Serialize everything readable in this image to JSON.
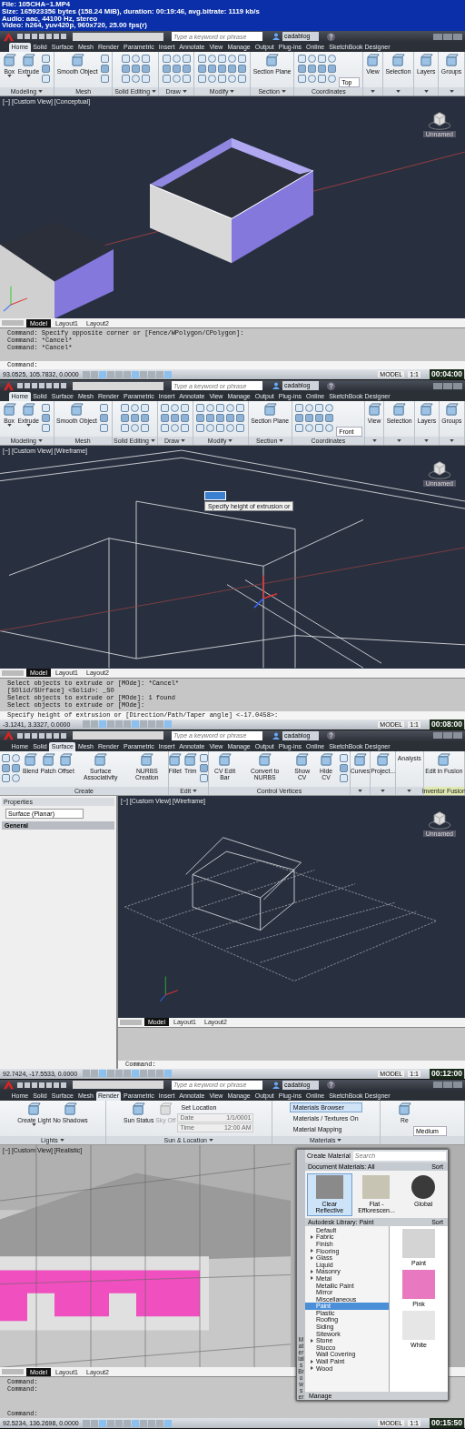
{
  "info": {
    "lines": [
      "File: 105CHA~1.MP4",
      "Size: 165923356 bytes (158.24 MiB), duration: 00:19:46, avg.bitrate: 1119 kb/s",
      "Audio: aac, 44100 Hz, stereo",
      "Video: h264, yuv420p, 960x720, 25.00 fps(r)"
    ]
  },
  "frames": [
    {
      "title_bar": {
        "search_placeholder": "Type a keyword or phrase",
        "user": "cadablog"
      },
      "tabs": [
        {
          "label": "Home",
          "selected": true
        },
        {
          "label": "Solid",
          "selected": false
        },
        {
          "label": "Surface",
          "selected": false
        },
        {
          "label": "Mesh",
          "selected": false
        },
        {
          "label": "Render",
          "selected": false
        },
        {
          "label": "Parametric",
          "selected": false
        },
        {
          "label": "Insert",
          "selected": false
        },
        {
          "label": "Annotate",
          "selected": false
        },
        {
          "label": "View",
          "selected": false
        },
        {
          "label": "Manage",
          "selected": false
        },
        {
          "label": "Output",
          "selected": false
        },
        {
          "label": "Plug-ins",
          "selected": false
        },
        {
          "label": "Online",
          "selected": false
        },
        {
          "label": "SketchBook Designer",
          "selected": false
        }
      ],
      "ribbon": [
        {
          "label": "Modeling",
          "menu": true,
          "tools": [
            {
              "kind": "large",
              "label": "Box",
              "menu": true
            },
            {
              "kind": "large",
              "label": "Extrude",
              "menu": true
            },
            {
              "kind": "column"
            }
          ]
        },
        {
          "label": "Mesh",
          "menu": false,
          "tools": [
            {
              "kind": "large",
              "label": "Smooth Object",
              "menu": false
            },
            {
              "kind": "column"
            }
          ]
        },
        {
          "label": "Solid Editing",
          "menu": true,
          "tools": [
            {
              "kind": "grid-three"
            }
          ]
        },
        {
          "label": "Draw",
          "menu": true,
          "tools": [
            {
              "kind": "grid-three"
            }
          ]
        },
        {
          "label": "Modify",
          "menu": true,
          "tools": [
            {
              "kind": "grid-five"
            }
          ]
        },
        {
          "label": "Section",
          "menu": true,
          "tools": [
            {
              "kind": "large",
              "label": "Section Plane",
              "menu": false
            }
          ]
        },
        {
          "label": "Coordinates",
          "menu": false,
          "tools": [
            {
              "kind": "grid-four"
            },
            {
              "kind": "dropdown",
              "value": "Top"
            }
          ]
        },
        {
          "menu": true,
          "tools": [
            {
              "kind": "large",
              "label": "View",
              "menu": false
            }
          ]
        },
        {
          "menu": true,
          "tools": [
            {
              "kind": "large",
              "label": "Selection",
              "menu": false
            }
          ]
        },
        {
          "menu": true,
          "tools": [
            {
              "kind": "large",
              "label": "Layers",
              "menu": false
            }
          ]
        },
        {
          "menu": true,
          "tools": [
            {
              "kind": "large",
              "label": "Groups",
              "menu": false
            }
          ]
        }
      ],
      "viewport": {
        "label": "[−] [Custom View] [Conceptual]",
        "kind": "boxes-conceptual",
        "viewcube": "Unnamed"
      },
      "layouts": [
        {
          "label": "Model",
          "selected": true
        },
        {
          "label": "Layout1",
          "selected": false
        },
        {
          "label": "Layout2",
          "selected": false
        }
      ],
      "command_lines": [
        "Command: Specify opposite corner or [Fence/WPolygon/CPolygon]:",
        "Command: *Cancel*",
        "Command: *Cancel*"
      ],
      "command_prompt": "Command:",
      "status": {
        "coordinates": "93.0525, 105.7832, 0.0000",
        "space": "MODEL",
        "scale": "1:1",
        "time": "00:04:00"
      }
    },
    {
      "title_bar": {
        "search_placeholder": "Type a keyword or phrase",
        "user": "cadablog"
      },
      "tabs": [
        {
          "label": "Home",
          "selected": true
        },
        {
          "label": "Solid",
          "selected": false
        },
        {
          "label": "Surface",
          "selected": false
        },
        {
          "label": "Mesh",
          "selected": false
        },
        {
          "label": "Render",
          "selected": false
        },
        {
          "label": "Parametric",
          "selected": false
        },
        {
          "label": "Insert",
          "selected": false
        },
        {
          "label": "Annotate",
          "selected": false
        },
        {
          "label": "View",
          "selected": false
        },
        {
          "label": "Manage",
          "selected": false
        },
        {
          "label": "Output",
          "selected": false
        },
        {
          "label": "Plug-ins",
          "selected": false
        },
        {
          "label": "Online",
          "selected": false
        },
        {
          "label": "SketchBook Designer",
          "selected": false
        }
      ],
      "ribbon": [
        {
          "label": "Modeling",
          "menu": true,
          "tools": [
            {
              "kind": "large",
              "label": "Box",
              "menu": true
            },
            {
              "kind": "large",
              "label": "Extrude",
              "menu": true
            },
            {
              "kind": "column"
            }
          ]
        },
        {
          "label": "Mesh",
          "menu": false,
          "tools": [
            {
              "kind": "large",
              "label": "Smooth Object",
              "menu": false
            },
            {
              "kind": "column"
            }
          ]
        },
        {
          "label": "Solid Editing",
          "menu": true,
          "tools": [
            {
              "kind": "grid-three"
            }
          ]
        },
        {
          "label": "Draw",
          "menu": true,
          "tools": [
            {
              "kind": "grid-three"
            }
          ]
        },
        {
          "label": "Modify",
          "menu": true,
          "tools": [
            {
              "kind": "grid-five"
            }
          ]
        },
        {
          "label": "Section",
          "menu": true,
          "tools": [
            {
              "kind": "large",
              "label": "Section Plane",
              "menu": false
            }
          ]
        },
        {
          "label": "Coordinates",
          "menu": false,
          "tools": [
            {
              "kind": "grid-four"
            },
            {
              "kind": "dropdown",
              "value": "Front"
            }
          ]
        },
        {
          "menu": true,
          "tools": [
            {
              "kind": "large",
              "label": "View",
              "menu": false
            }
          ]
        },
        {
          "menu": true,
          "tools": [
            {
              "kind": "large",
              "label": "Selection",
              "menu": false
            }
          ]
        },
        {
          "menu": true,
          "tools": [
            {
              "kind": "large",
              "label": "Layers",
              "menu": false
            }
          ]
        },
        {
          "menu": true,
          "tools": [
            {
              "kind": "large",
              "label": "Groups",
              "menu": false
            }
          ]
        }
      ],
      "viewport": {
        "label": "[−] [Custom View] [Wireframe]",
        "kind": "boxes-wireframe",
        "viewcube": "Unnamed",
        "tooltip": "Specify height of extrusion or"
      },
      "layouts": [
        {
          "label": "Model",
          "selected": true
        },
        {
          "label": "Layout1",
          "selected": false
        },
        {
          "label": "Layout2",
          "selected": false
        }
      ],
      "command_lines": [
        "Select objects to extrude or [MOde]: *Cancel*",
        "[SOlid/SUrface] <Solid>: _SO",
        "Select objects to extrude or [MOde]: 1 found",
        "Select objects to extrude or [MOde]:"
      ],
      "command_prompt": "Specify height of extrusion or [Direction/Path/Taper angle] <-17.0458>:",
      "status": {
        "coordinates": "-3.1241, 3.3327, 0.0000",
        "space": "MODEL",
        "scale": "1:1",
        "time": "00:08:00"
      }
    },
    {
      "title_bar": {
        "search_placeholder": "Type a keyword or phrase",
        "user": "cadablog"
      },
      "tabs": [
        {
          "label": "Home",
          "selected": false
        },
        {
          "label": "Solid",
          "selected": false
        },
        {
          "label": "Surface",
          "selected": true
        },
        {
          "label": "Mesh",
          "selected": false
        },
        {
          "label": "Render",
          "selected": false
        },
        {
          "label": "Parametric",
          "selected": false
        },
        {
          "label": "Insert",
          "selected": false
        },
        {
          "label": "Annotate",
          "selected": false
        },
        {
          "label": "View",
          "selected": false
        },
        {
          "label": "Manage",
          "selected": false
        },
        {
          "label": "Output",
          "selected": false
        },
        {
          "label": "Plug-ins",
          "selected": false
        },
        {
          "label": "Online",
          "selected": false
        },
        {
          "label": "SketchBook Designer",
          "selected": false
        }
      ],
      "ribbon": [
        {
          "label": "Create",
          "menu": false,
          "tools": [
            {
              "kind": "grid-two"
            },
            {
              "kind": "large",
              "label": "Blend",
              "menu": false
            },
            {
              "kind": "large",
              "label": "Patch",
              "menu": false
            },
            {
              "kind": "large",
              "label": "Offset",
              "menu": false
            },
            {
              "kind": "large",
              "label": "Surface Associativity",
              "menu": false
            },
            {
              "kind": "large",
              "label": "NURBS Creation",
              "menu": false
            }
          ]
        },
        {
          "label": "Edit",
          "menu": true,
          "tools": [
            {
              "kind": "large",
              "label": "Fillet",
              "menu": false
            },
            {
              "kind": "large",
              "label": "Trim",
              "menu": false
            },
            {
              "kind": "column"
            }
          ]
        },
        {
          "label": "Control Vertices",
          "menu": false,
          "tools": [
            {
              "kind": "large",
              "label": "CV Edit Bar",
              "menu": false
            },
            {
              "kind": "large",
              "label": "Convert to NURBS",
              "menu": false
            },
            {
              "kind": "large",
              "label": "Show CV",
              "menu": false
            },
            {
              "kind": "large",
              "label": "Hide CV",
              "menu": false
            },
            {
              "kind": "column"
            }
          ]
        },
        {
          "menu": true,
          "tools": [
            {
              "kind": "large",
              "label": "Curves",
              "menu": false
            }
          ]
        },
        {
          "menu": true,
          "tools": [
            {
              "kind": "large",
              "label": "Project...",
              "menu": false
            }
          ]
        },
        {
          "menu": true,
          "tools": [
            {
              "kind": "text",
              "label": "Analysis"
            }
          ]
        },
        {
          "label": "Inventor Fusion",
          "menu": false,
          "tools": [
            {
              "kind": "large",
              "label": "Edit in Fusion",
              "menu": false
            }
          ]
        }
      ],
      "properties": {
        "title": "Properties",
        "selection": "Surface (Planar)",
        "section": "General"
      },
      "viewport": {
        "label": "[−] [Custom View] [Wireframe]",
        "kind": "house-wireframe",
        "viewcube": "Unnamed"
      },
      "layouts": [
        {
          "label": "Model",
          "selected": true
        },
        {
          "label": "Layout1",
          "selected": false
        },
        {
          "label": "Layout2",
          "selected": false
        }
      ],
      "command_prompt": "Command:",
      "status": {
        "coordinates": "92.7424, -17.5533, 0.0000",
        "space": "MODEL",
        "scale": "1:1",
        "time": "00:12:00"
      }
    },
    {
      "title_bar": {
        "search_placeholder": "Type a keyword or phrase",
        "user": "cadablog"
      },
      "tabs": [
        {
          "label": "Home",
          "selected": false
        },
        {
          "label": "Solid",
          "selected": false
        },
        {
          "label": "Surface",
          "selected": false
        },
        {
          "label": "Mesh",
          "selected": false
        },
        {
          "label": "Render",
          "selected": true
        },
        {
          "label": "Parametric",
          "selected": false
        },
        {
          "label": "Insert",
          "selected": false
        },
        {
          "label": "Annotate",
          "selected": false
        },
        {
          "label": "View",
          "selected": false
        },
        {
          "label": "Manage",
          "selected": false
        },
        {
          "label": "Output",
          "selected": false
        },
        {
          "label": "Plug-ins",
          "selected": false
        },
        {
          "label": "Online",
          "selected": false
        },
        {
          "label": "SketchBook Designer",
          "selected": false
        }
      ],
      "ribbon": [
        {
          "label": "Lights",
          "menu": true,
          "tools": [
            {
              "kind": "large",
              "label": "Create Light",
              "menu": true,
              "disabled": false
            },
            {
              "kind": "large",
              "label": "No Shadows",
              "menu": false,
              "disabled": false
            }
          ]
        },
        {
          "label": "Sun & Location",
          "menu": true,
          "tools": [
            {
              "kind": "large",
              "label": "Sun Status",
              "menu": false,
              "disabled": false
            },
            {
              "kind": "large",
              "label": "Sky Off",
              "menu": false,
              "disabled": true
            },
            {
              "kind": "stack",
              "rows": [
                {
                  "kind": "link",
                  "label": "Set Location",
                  "selected": false
                },
                {
                  "kind": "field",
                  "label": "Date",
                  "value": "1/1/0001",
                  "disabled": true
                },
                {
                  "kind": "field",
                  "label": "Time",
                  "value": "12:00 AM",
                  "disabled": true
                }
              ]
            }
          ]
        },
        {
          "label": "Materials",
          "menu": true,
          "tools": [
            {
              "kind": "stack",
              "rows": [
                {
                  "kind": "link",
                  "label": "Materials Browser",
                  "selected": true
                },
                {
                  "kind": "link",
                  "label": "Materials / Textures On",
                  "selected": false
                },
                {
                  "kind": "link",
                  "label": "Material Mapping",
                  "selected": false
                }
              ]
            }
          ]
        },
        {
          "menu": false,
          "tools": [
            {
              "kind": "large",
              "label": "Re",
              "menu": false,
              "disabled": false
            },
            {
              "kind": "dropdown",
              "value": "Medium"
            }
          ]
        }
      ],
      "materials_browser": {
        "title": "Materials Browser",
        "create": "Create Material",
        "search_placeholder": "Search",
        "document_header": "Document Materials: All",
        "document_sort": "Sort",
        "document_materials": [
          {
            "label": "Clear Reflective",
            "selected": true,
            "kind": "glass"
          },
          {
            "label": "Flat - Efflorescen...",
            "selected": false,
            "kind": "cube"
          },
          {
            "label": "Global",
            "selected": false,
            "kind": "sphere"
          }
        ],
        "library_header": "Autodesk Library: Paint",
        "library_sort": "Sort",
        "categories": [
          {
            "label": "Default",
            "expandable": false,
            "selected": false
          },
          {
            "label": "Fabric",
            "expandable": true,
            "selected": false
          },
          {
            "label": "Finish",
            "expandable": false,
            "selected": false
          },
          {
            "label": "Flooring",
            "expandable": true,
            "selected": false
          },
          {
            "label": "Glass",
            "expandable": true,
            "selected": false
          },
          {
            "label": "Liquid",
            "expandable": false,
            "selected": false
          },
          {
            "label": "Masonry",
            "expandable": true,
            "selected": false
          },
          {
            "label": "Metal",
            "expandable": true,
            "selected": false
          },
          {
            "label": "Metallic Paint",
            "expandable": false,
            "selected": false
          },
          {
            "label": "Mirror",
            "expandable": false,
            "selected": false
          },
          {
            "label": "Miscellaneous",
            "expandable": false,
            "selected": false
          },
          {
            "label": "Paint",
            "expandable": false,
            "selected": true
          },
          {
            "label": "Plastic",
            "expandable": false,
            "selected": false
          },
          {
            "label": "Roofing",
            "expandable": false,
            "selected": false
          },
          {
            "label": "Siding",
            "expandable": false,
            "selected": false
          },
          {
            "label": "Sitework",
            "expandable": false,
            "selected": false
          },
          {
            "label": "Stone",
            "expandable": true,
            "selected": false
          },
          {
            "label": "Stucco",
            "expandable": false,
            "selected": false
          },
          {
            "label": "Wall Covering",
            "expandable": false,
            "selected": false
          },
          {
            "label": "Wall Paint",
            "expandable": true,
            "selected": false
          },
          {
            "label": "Wood",
            "expandable": true,
            "selected": false
          }
        ],
        "swatches": [
          {
            "label": "Paint",
            "color": "#d4d4d4"
          },
          {
            "label": "Pink",
            "color": "#e879c0"
          },
          {
            "label": "White",
            "color": "#e6e6e6"
          }
        ],
        "manage": "Manage"
      },
      "viewport": {
        "label": "[−] [Custom View] [Realistic]",
        "kind": "house-realistic"
      },
      "layouts": [
        {
          "label": "Model",
          "selected": true
        },
        {
          "label": "Layout1",
          "selected": false
        },
        {
          "label": "Layout2",
          "selected": false
        }
      ],
      "command_lines": [
        "Command:",
        "Command:"
      ],
      "command_prompt": "Command:",
      "status": {
        "coordinates": "92.5234, 136.2698, 0.0000",
        "space": "MODEL",
        "scale": "1:1",
        "time": "00:15:50"
      }
    }
  ]
}
